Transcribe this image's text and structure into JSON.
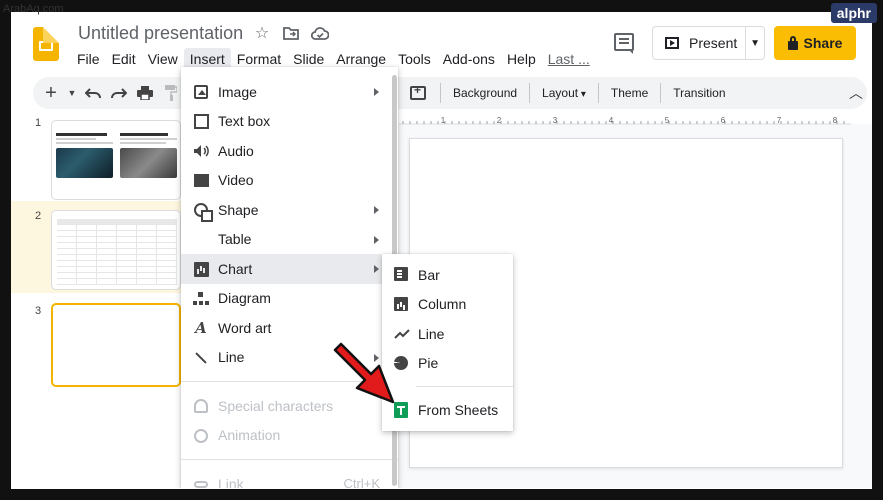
{
  "watermark": "ArabAq.com",
  "alphr_logo": "alphr",
  "header": {
    "title": "Untitled presentation",
    "icons": [
      "star-icon",
      "move-folder-icon",
      "cloud-status-icon"
    ],
    "menu": [
      "File",
      "Edit",
      "View",
      "Insert",
      "Format",
      "Slide",
      "Arrange",
      "Tools",
      "Add-ons",
      "Help",
      "Last ..."
    ],
    "active_menu": "Insert",
    "present_label": "Present",
    "share_label": "Share",
    "share_color": "#fbbc04"
  },
  "toolbar": {
    "icons": [
      "new-slide-icon",
      "new-slide-dropdown-icon",
      "undo-icon",
      "redo-icon",
      "print-icon",
      "paint-format-icon"
    ],
    "background_label": "Background",
    "layout_label": "Layout",
    "theme_label": "Theme",
    "transition_label": "Transition"
  },
  "ruler_ticks": [
    "1",
    "2",
    "3",
    "4",
    "5",
    "6",
    "7",
    "8"
  ],
  "filmstrip": {
    "slides": [
      {
        "number": "1"
      },
      {
        "number": "2"
      },
      {
        "number": "3",
        "selected": true
      }
    ]
  },
  "insert_menu": {
    "items": [
      {
        "label": "Image",
        "icon": "image-icon",
        "submenu": true
      },
      {
        "label": "Text box",
        "icon": "text-box-icon"
      },
      {
        "label": "Audio",
        "icon": "audio-icon"
      },
      {
        "label": "Video",
        "icon": "video-icon"
      },
      {
        "label": "Shape",
        "icon": "shape-icon",
        "submenu": true
      },
      {
        "label": "Table",
        "icon": "",
        "submenu": true
      },
      {
        "label": "Chart",
        "icon": "chart-icon",
        "submenu": true,
        "highlighted": true
      },
      {
        "label": "Diagram",
        "icon": "diagram-icon"
      },
      {
        "label": "Word art",
        "icon": "word-art-icon"
      },
      {
        "label": "Line",
        "icon": "line-icon",
        "submenu": true
      },
      {
        "label": "Special characters",
        "icon": "special-characters-icon",
        "disabled": true
      },
      {
        "label": "Animation",
        "icon": "animation-icon",
        "disabled": true
      },
      {
        "label": "Link",
        "icon": "link-icon",
        "disabled": true,
        "shortcut": "Ctrl+K"
      }
    ]
  },
  "chart_menu": {
    "items": [
      {
        "label": "Bar",
        "icon": "bar-chart-icon"
      },
      {
        "label": "Column",
        "icon": "column-chart-icon"
      },
      {
        "label": "Line",
        "icon": "line-chart-icon"
      },
      {
        "label": "Pie",
        "icon": "pie-chart-icon"
      },
      {
        "label": "From Sheets",
        "icon": "sheets-icon"
      }
    ]
  },
  "annotation": {
    "icon": "red-arrow-icon",
    "color": "#e11b1b"
  }
}
